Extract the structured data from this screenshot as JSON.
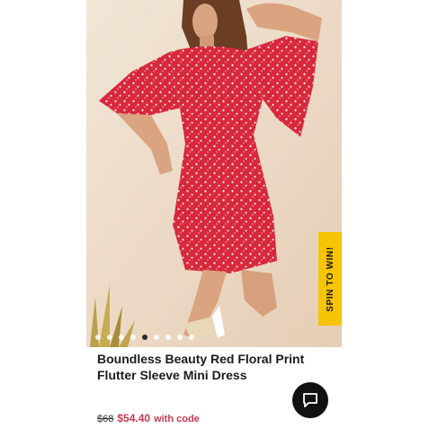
{
  "product": {
    "title_line1": "Boundless Beauty Red Floral Print",
    "title_line2": "Flutter Sleeve Mini Dress",
    "original_price": "$68",
    "sale_price": "$54.40",
    "price_note": "with code"
  },
  "promo_tab": {
    "label": "SPIN TO WIN!"
  },
  "carousel": {
    "total_images": 9,
    "active_index": 4
  },
  "icons": {
    "chat": "chat-bubble-icon"
  },
  "colors": {
    "dress": "#d8283c",
    "promo_tab": "#f6c400",
    "sale_price": "#c43a52",
    "chat_button": "#111111"
  }
}
